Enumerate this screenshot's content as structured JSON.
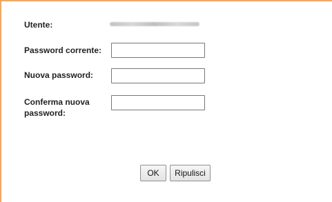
{
  "form": {
    "user_label": "Utente:",
    "user_value": "",
    "current_password_label": "Password corrente:",
    "current_password_value": "",
    "new_password_label": "Nuova password:",
    "new_password_value": "",
    "confirm_password_label_line1": "Conferma nuova",
    "confirm_password_label_line2": "password:",
    "confirm_password_value": ""
  },
  "buttons": {
    "ok_label": "OK",
    "reset_label": "Ripulisci"
  },
  "colors": {
    "frame_border": "#f0a868"
  }
}
